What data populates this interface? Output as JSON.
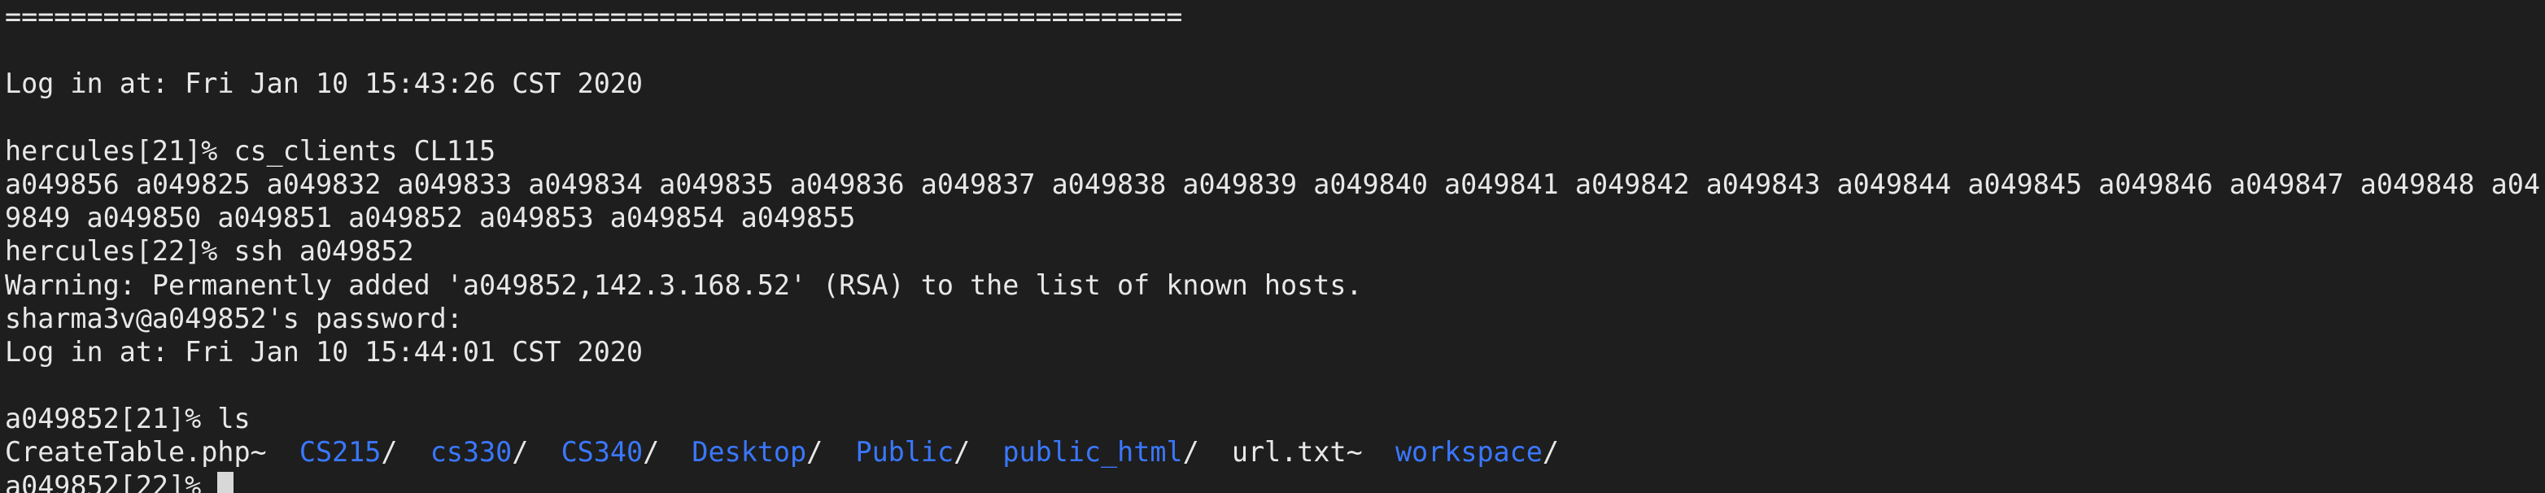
{
  "terminal": {
    "separator": "========================================================================",
    "login1": "Log in at: Fri Jan 10 15:43:26 CST 2020",
    "prompt1": "hercules[21]% cs_clients CL115",
    "clients_line1": "a049856 a049825 a049832 a049833 a049834 a049835 a049836 a049837 a049838 a049839 a049840 a049841 a049842 a049843 a049844 a049845 a049846 a049847 a049848 a04",
    "clients_line2": "9849 a049850 a049851 a049852 a049853 a049854 a049855",
    "prompt2": "hercules[22]% ssh a049852",
    "warning": "Warning: Permanently added 'a049852,142.3.168.52' (RSA) to the list of known hosts.",
    "password_prompt": "sharma3v@a049852's password:",
    "login2": "Log in at: Fri Jan 10 15:44:01 CST 2020",
    "prompt3": "a049852[21]% ls",
    "ls_entries": [
      {
        "name": "CreateTable.php~",
        "suffix": "",
        "type": "file"
      },
      {
        "name": "CS215",
        "suffix": "/",
        "type": "dir"
      },
      {
        "name": "cs330",
        "suffix": "/",
        "type": "dir"
      },
      {
        "name": "CS340",
        "suffix": "/",
        "type": "dir"
      },
      {
        "name": "Desktop",
        "suffix": "/",
        "type": "dir"
      },
      {
        "name": "Public",
        "suffix": "/",
        "type": "dir"
      },
      {
        "name": "public_html",
        "suffix": "/",
        "type": "dir"
      },
      {
        "name": "url.txt~",
        "suffix": "",
        "type": "file"
      },
      {
        "name": "workspace",
        "suffix": "/",
        "type": "dir"
      }
    ],
    "prompt4": "a049852[22]% ",
    "colors": {
      "background": "#1e1e1e",
      "foreground": "#e8e8e8",
      "directory": "#3a78ff",
      "cursor": "#d8d8d8"
    }
  }
}
